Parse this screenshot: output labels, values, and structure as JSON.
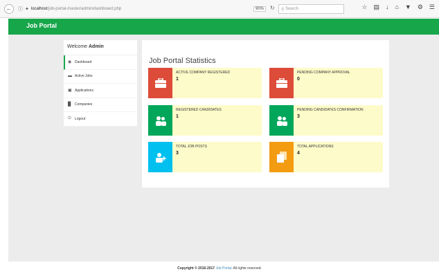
{
  "browser": {
    "url_host": "localhost",
    "url_path": "/job-portal-master/admin/dashboard.php",
    "zoom": "90%",
    "search_placeholder": "Search"
  },
  "navbar": {
    "brand": "Job Portal"
  },
  "sidebar": {
    "welcome_prefix": "Welcome",
    "welcome_user": "Admin",
    "items": [
      {
        "label": "Dashboard",
        "icon": "dashboard-icon"
      },
      {
        "label": "Active Jobs",
        "icon": "briefcase-icon"
      },
      {
        "label": "Applications",
        "icon": "address-card-icon"
      },
      {
        "label": "Companies",
        "icon": "building-icon"
      },
      {
        "label": "Logout",
        "icon": "power-icon"
      }
    ]
  },
  "stats": {
    "title": "Job Portal Statistics",
    "cards": [
      {
        "label": "ACTIVE COMPANY REGISTERED",
        "value": "1",
        "color": "#dd4b39",
        "icon": "briefcase-icon"
      },
      {
        "label": "PENDING COMPANY APPROVAL",
        "value": "0",
        "color": "#dd4b39",
        "icon": "briefcase-icon"
      },
      {
        "label": "REGISTERED CANDIDATES",
        "value": "1",
        "color": "#00a65a",
        "icon": "users-icon"
      },
      {
        "label": "PENDING CANDIDATES CONFIRMATION",
        "value": "3",
        "color": "#00a65a",
        "icon": "users-icon"
      },
      {
        "label": "TOTAL JOB POSTS",
        "value": "3",
        "color": "#00c0ef",
        "icon": "user-plus-icon"
      },
      {
        "label": "TOTAL APPLICATIONS",
        "value": "4",
        "color": "#f39c12",
        "icon": "files-icon"
      }
    ]
  },
  "footer": {
    "prefix": "Copyright © 2016-2017",
    "link": "Job Portal",
    "suffix": ". All rights reserved."
  },
  "colors": {
    "navbar": "#18a64b",
    "card_bg": "#fdfbc9"
  }
}
